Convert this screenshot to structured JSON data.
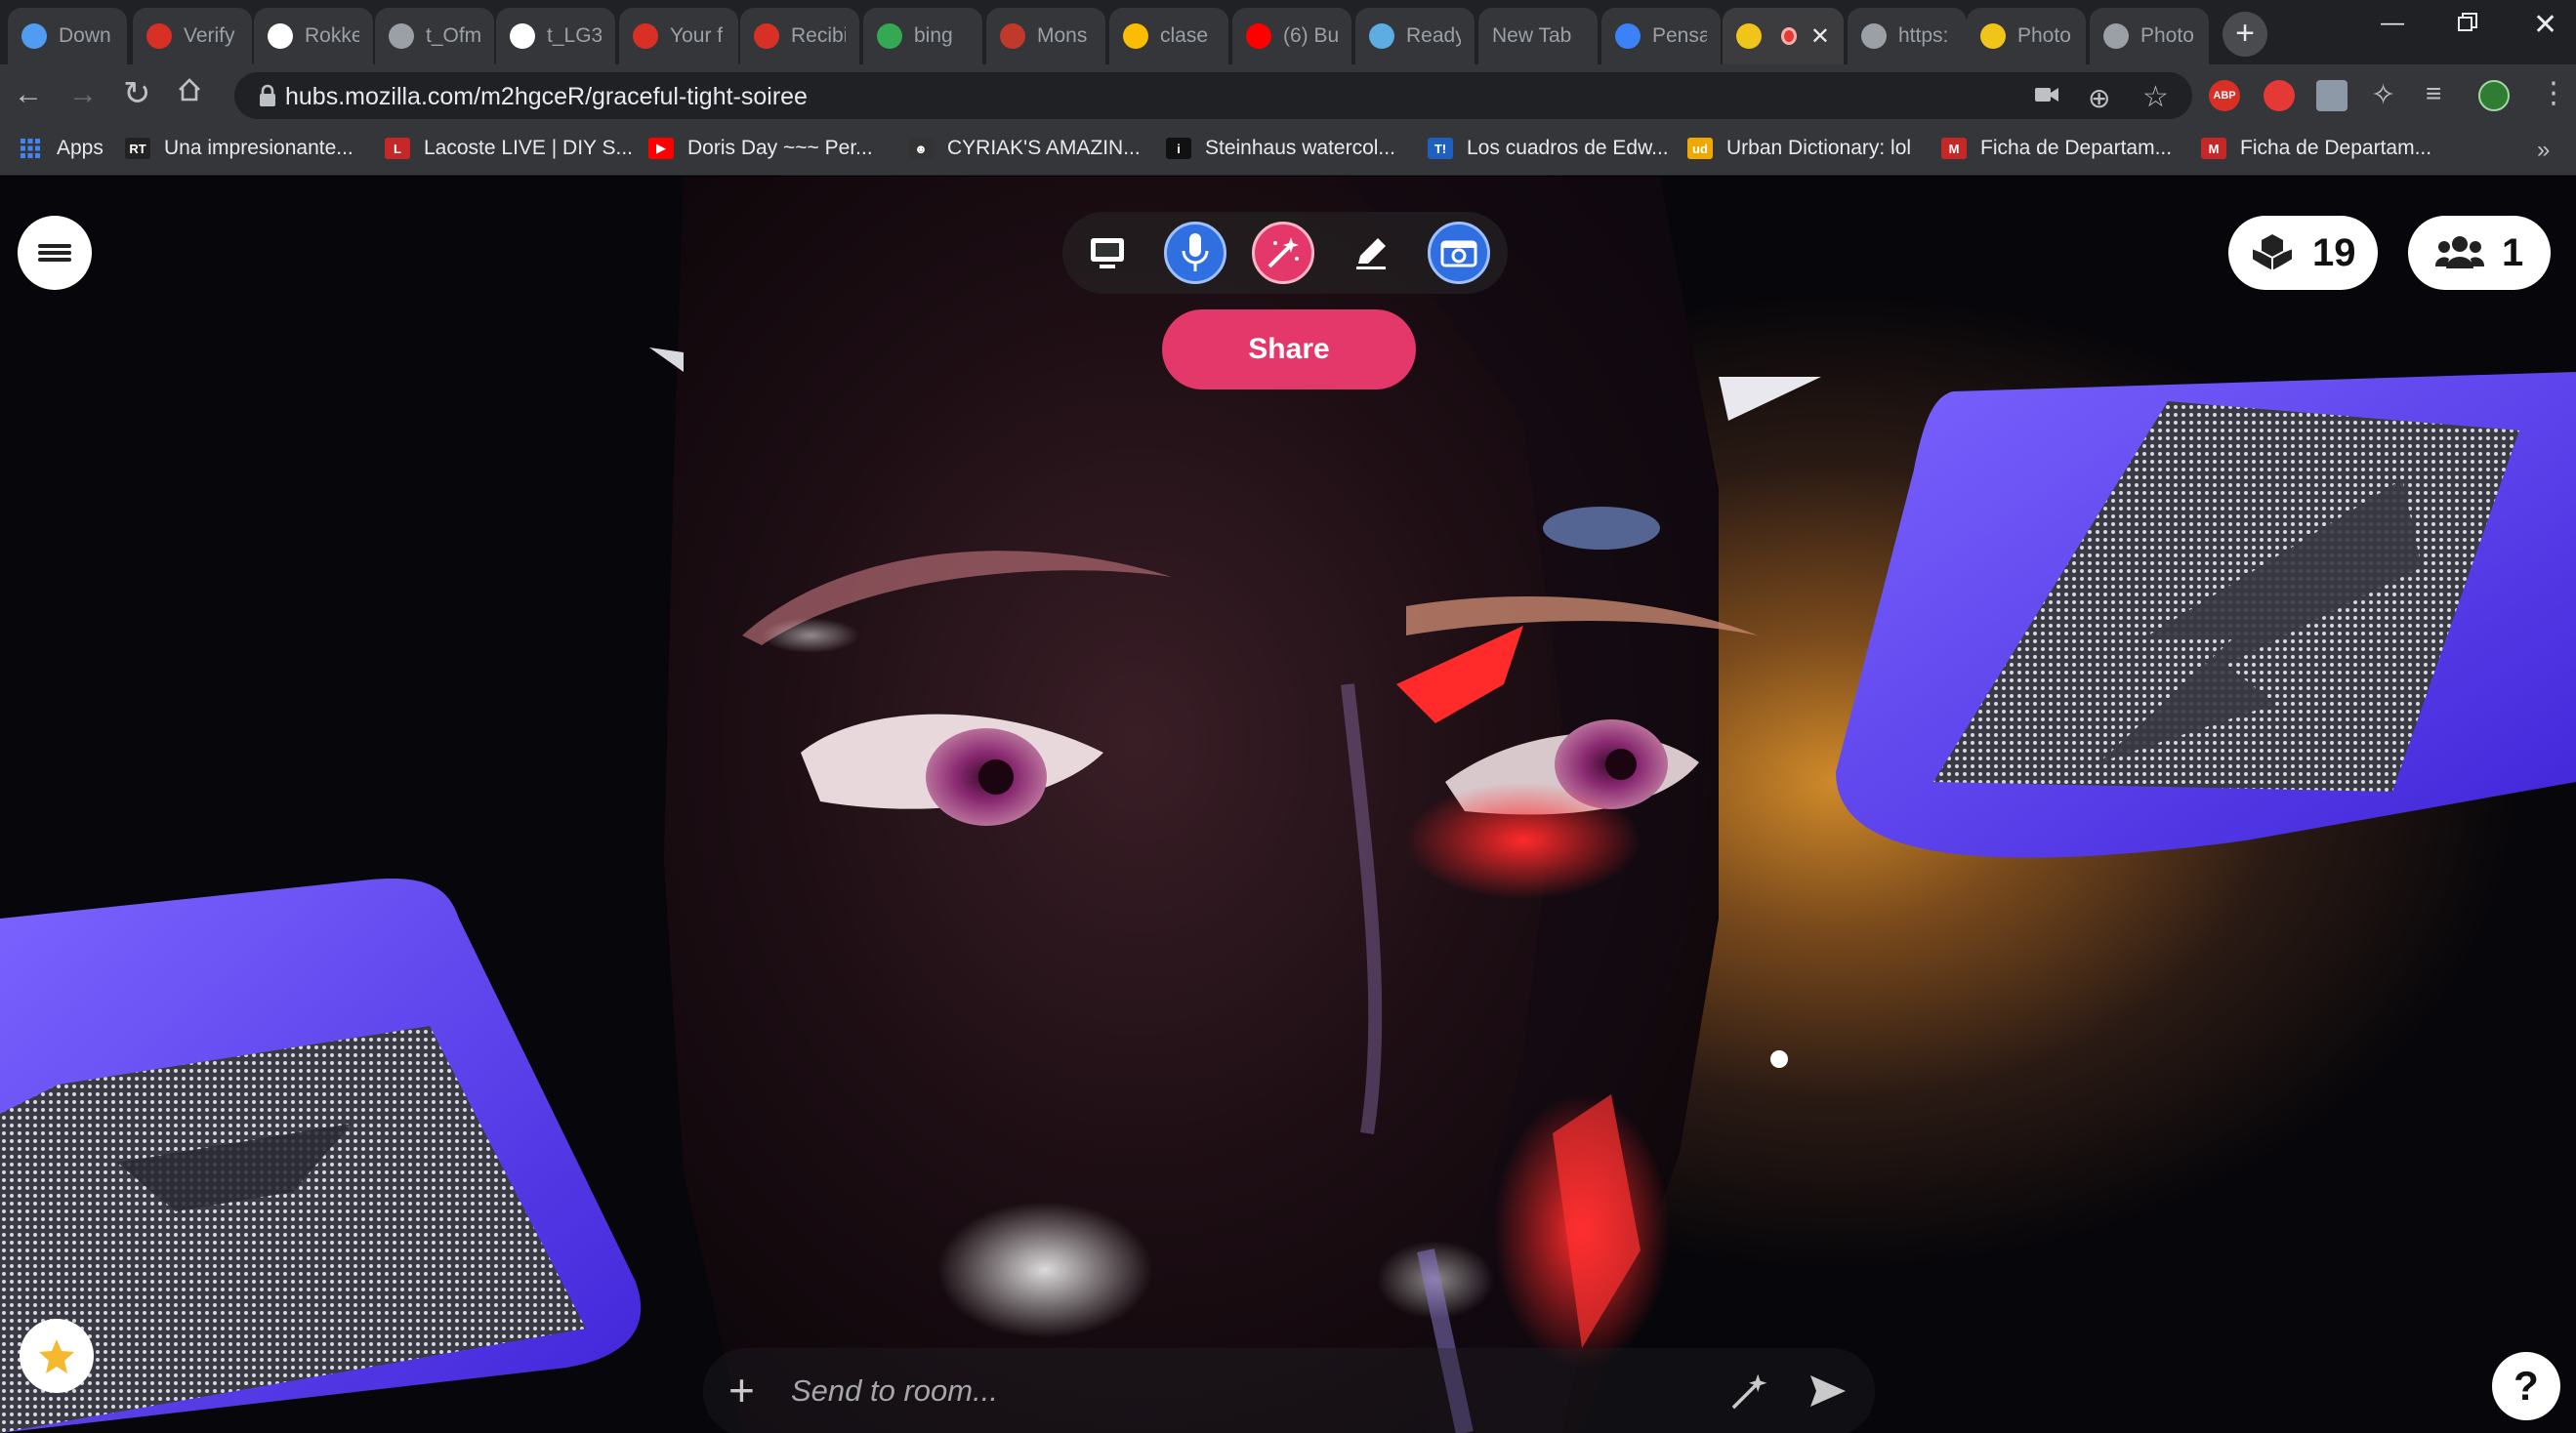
{
  "browser": {
    "tabs": [
      {
        "title": "Down",
        "fav_color": "#4f9cf0"
      },
      {
        "title": "Verify",
        "fav_color": "#d93025"
      },
      {
        "title": "Rokke",
        "fav_color": "#ffffff"
      },
      {
        "title": "t_Ofm",
        "fav_color": "#9aa0a6"
      },
      {
        "title": "t_LG3",
        "fav_color": "#ffffff"
      },
      {
        "title": "Your f",
        "fav_color": "#d93025"
      },
      {
        "title": "Recibi",
        "fav_color": "#d93025"
      },
      {
        "title": "bing",
        "fav_color": "#34a853"
      },
      {
        "title": "Mons",
        "fav_color": "#c0392b"
      },
      {
        "title": "clase",
        "fav_color": "#fbbc04"
      },
      {
        "title": "(6) Bu",
        "fav_color": "#ff0000"
      },
      {
        "title": "Ready",
        "fav_color": "#5dade2"
      },
      {
        "title": "New Tab",
        "fav_color": ""
      },
      {
        "title": "Pensa",
        "fav_color": "#3b82f6"
      },
      {
        "title": "",
        "fav_color": "#f0c419",
        "active": true
      },
      {
        "title": "https:",
        "fav_color": "#9aa0a6"
      },
      {
        "title": "Photo",
        "fav_color": "#f0c419"
      },
      {
        "title": "Photo",
        "fav_color": "#9aa0a6"
      }
    ],
    "url_host": "hubs.mozilla.com",
    "url_path": "/m2hgceR/graceful-tight-soiree",
    "bookmarks": [
      {
        "label": "Apps",
        "icon_color": "#4285f4",
        "icon": "grid"
      },
      {
        "label": "Una impresionante...",
        "icon_color": "#222222",
        "icon": "RT"
      },
      {
        "label": "Lacoste LIVE | DIY S...",
        "icon_color": "#c62828",
        "icon": "L"
      },
      {
        "label": "Doris Day ~~~ Per...",
        "icon_color": "#ff0000",
        "icon": "▶"
      },
      {
        "label": "CYRIAK'S AMAZIN...",
        "icon_color": "#333333",
        "icon": "☻"
      },
      {
        "label": "Steinhaus watercol...",
        "icon_color": "#111111",
        "icon": "i"
      },
      {
        "label": "Los cuadros de Edw...",
        "icon_color": "#1e5fbf",
        "icon": "T!"
      },
      {
        "label": "Urban Dictionary: lol",
        "icon_color": "#f0a800",
        "icon": "ud"
      },
      {
        "label": "Ficha de Departam...",
        "icon_color": "#c62828",
        "icon": "M"
      },
      {
        "label": "Ficha de Departam...",
        "icon_color": "#c62828",
        "icon": "M"
      }
    ]
  },
  "hubs": {
    "share_label": "Share",
    "objects_count": "19",
    "people_count": "1",
    "chat_placeholder": "Send to room...",
    "colors": {
      "accent": "#e4386a",
      "tool_blue": "#2f6fe0",
      "tool_pink": "#e4386a",
      "slab": "#5b3df2"
    }
  }
}
